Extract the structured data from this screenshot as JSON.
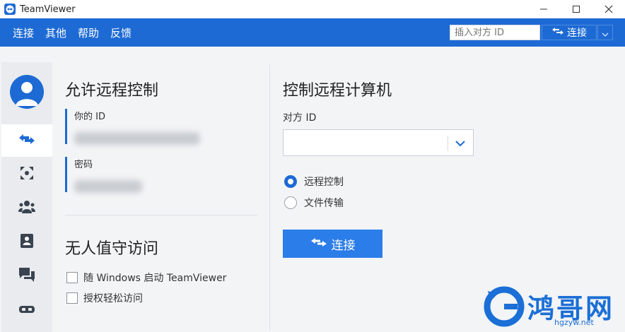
{
  "window": {
    "title": "TeamViewer",
    "controls": {
      "minimize": "—",
      "maximize": "☐",
      "close": "✕"
    }
  },
  "menubar": {
    "items": [
      "连接",
      "其他",
      "帮助",
      "反馈"
    ],
    "quick_input_placeholder": "插入对方 ID",
    "quick_connect_label": "连接"
  },
  "sidebar": {
    "items": [
      "avatar",
      "remote-control",
      "meeting",
      "contacts",
      "computers-contacts",
      "chat",
      "augmented-reality"
    ],
    "active": "remote-control"
  },
  "left_panel": {
    "title": "允许远程控制",
    "your_id_label": "你的 ID",
    "password_label": "密码",
    "unattended_title": "无人值守访问",
    "checkbox_start_windows": "随 Windows 启动 TeamViewer",
    "checkbox_easy_access": "授权轻松访问"
  },
  "right_panel": {
    "title": "控制远程计算机",
    "partner_id_label": "对方 ID",
    "partner_id_value": "",
    "radio_remote_control": "远程控制",
    "radio_file_transfer": "文件传输",
    "selected_mode": "远程控制",
    "connect_button": "连接"
  },
  "watermark": {
    "text": "鸿哥网",
    "url": "hgzyw.net"
  },
  "colors": {
    "brand_blue": "#1d6ad4",
    "button_blue": "#2b7de9"
  }
}
